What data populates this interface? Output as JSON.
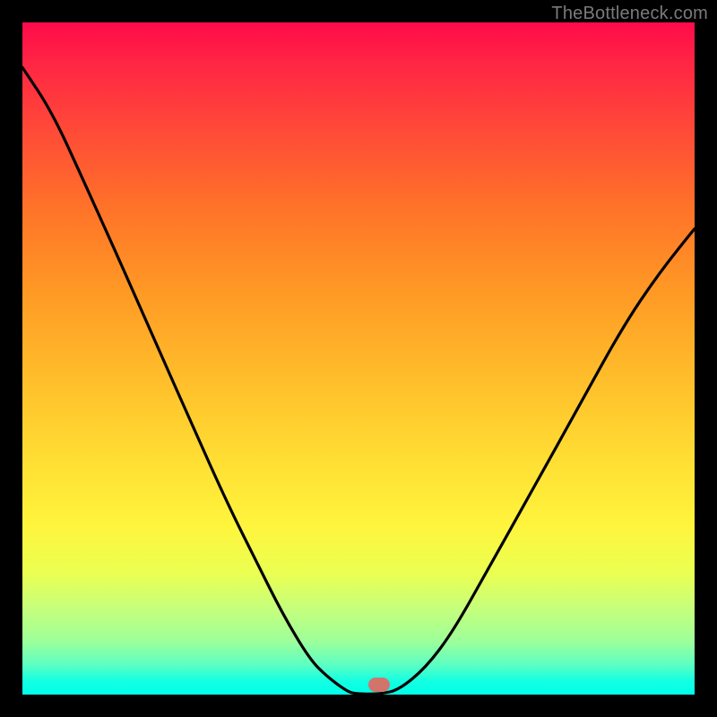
{
  "watermark": {
    "text": "TheBottleneck.com"
  },
  "marker": {
    "x_frac": 0.53,
    "y_frac": 0.985,
    "color": "#d1746b"
  },
  "chart_data": {
    "type": "line",
    "title": "",
    "xlabel": "",
    "ylabel": "",
    "xlim": [
      0,
      1
    ],
    "ylim": [
      0,
      1
    ],
    "annotations": [
      "TheBottleneck.com"
    ],
    "legend": false,
    "grid": false,
    "description": "V-shaped black curve on a vertical rainbow (red→green) gradient. Left branch descends from top-left to a flat minimum near x≈0.5, right branch rises toward the right edge. A small rounded marker sits at the minimum.",
    "series": [
      {
        "name": "curve",
        "x": [
          0.0,
          0.044,
          0.093,
          0.147,
          0.2,
          0.253,
          0.307,
          0.347,
          0.387,
          0.427,
          0.453,
          0.48,
          0.493,
          0.533,
          0.56,
          0.6,
          0.64,
          0.693,
          0.76,
          0.827,
          0.893,
          0.947,
          1.0
        ],
        "values": [
          0.933,
          0.867,
          0.76,
          0.64,
          0.52,
          0.4,
          0.28,
          0.2,
          0.12,
          0.053,
          0.027,
          0.007,
          0.001,
          0.001,
          0.007,
          0.04,
          0.093,
          0.187,
          0.307,
          0.427,
          0.547,
          0.627,
          0.693
        ]
      }
    ]
  }
}
